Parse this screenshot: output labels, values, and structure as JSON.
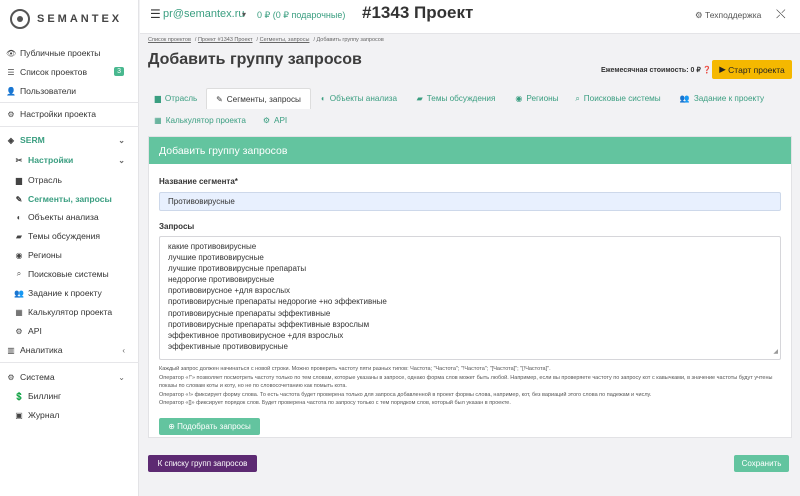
{
  "logo": {
    "text": "SEMANTEX"
  },
  "sidebar": {
    "items": [
      {
        "icon": "👁",
        "label": "Публичные проекты"
      },
      {
        "icon": "☰",
        "label": "Список проектов",
        "badge": "3"
      },
      {
        "icon": "👤",
        "label": "Пользователи"
      },
      {
        "icon": "⚙",
        "label": "Настройки проекта"
      },
      {
        "icon": "◈",
        "label": "SERM"
      },
      {
        "icon": "✂",
        "label": "Настройки"
      },
      {
        "icon": "▆",
        "label": "Отрасль"
      },
      {
        "icon": "✎",
        "label": "Сегменты, запросы"
      },
      {
        "icon": "◐",
        "label": "Объекты анализа"
      },
      {
        "icon": "▰",
        "label": "Темы обсуждения"
      },
      {
        "icon": "◉",
        "label": "Регионы"
      },
      {
        "icon": "⌕",
        "label": "Поисковые системы"
      },
      {
        "icon": "👥",
        "label": "Задание к проекту"
      },
      {
        "icon": "▦",
        "label": "Калькулятор проекта"
      },
      {
        "icon": "⚙",
        "label": "API"
      },
      {
        "icon": "▥",
        "label": "Аналитика"
      },
      {
        "icon": "⚙",
        "label": "Система"
      },
      {
        "icon": "💲",
        "label": "Биллинг"
      },
      {
        "icon": "▣",
        "label": "Журнал"
      }
    ]
  },
  "topbar": {
    "email": "pr@semantex.ru",
    "balance": "0 ₽ (0 ₽ подарочные)",
    "project_title": "#1343 Проект",
    "support": "Техподдержка"
  },
  "breadcrumb": [
    "Список проектов",
    "Проект #1343 Проект",
    "Сегменты, запросы",
    "Добавить группу запросов"
  ],
  "page": {
    "title": "Добавить группу запросов",
    "monthly_cost": "Ежемесячная стоимость: 0 ₽",
    "start_button": "Старт проекта"
  },
  "tabs": [
    {
      "icon": "▆",
      "label": "Отрасль"
    },
    {
      "icon": "✎",
      "label": "Сегменты, запросы"
    },
    {
      "icon": "◐",
      "label": "Объекты анализа"
    },
    {
      "icon": "▰",
      "label": "Темы обсуждения"
    },
    {
      "icon": "◉",
      "label": "Регионы"
    },
    {
      "icon": "⌕",
      "label": "Поисковые системы"
    },
    {
      "icon": "👥",
      "label": "Задание к проекту"
    },
    {
      "icon": "▦",
      "label": "Калькулятор проекта"
    },
    {
      "icon": "⚙",
      "label": "API"
    }
  ],
  "form": {
    "card_title": "Добавить группу запросов",
    "segment_label": "Название сегмента*",
    "segment_value": "Противовирусные",
    "queries_label": "Запросы",
    "queries": [
      "какие противовирусные",
      "лучшие противовирусные",
      "лучшие противовирусные препараты",
      "недорогие противовирусные",
      "противовирусное +для взрослых",
      "противовирусные препараты недорогие +но эффективные",
      "противовирусные препараты эффективные",
      "противовирусные препараты эффективные взрослым",
      "эффективное противовирусное +для взрослых",
      "эффективные противовирусные"
    ],
    "help": [
      "Каждый запрос должен начинаться с новой строки. Можно проверить частоту пяти разных типов: Частота; \"Частота\"; \"!Частота\"; \"[Частота]\"; \"[!Частота]\".",
      "Оператор «!\"» позволяет посмотреть частоту только по тем словам, которые указаны в запросе, однако форма слов может быть любой. Например, если вы проверяете частоту по запросу кот с кавычками, в значение частоты будут учтены показы по словам коты и коту, но не по словосочетанию как помыть кота.",
      "Оператор «!» фиксирует форму слова. То есть частота будет проверена только для запроса добавленной в проект формы слова, например, кот, без вариаций этого слова по падежам и числу.",
      "Оператор «[]» фиксирует порядок слов. Будет проверена частота по запросу только с тем порядком слов, который был указан в проекте."
    ],
    "pick_button": "Подобрать запросы"
  },
  "footer": {
    "back_button": "К списку групп запросов",
    "save_button": "Сохранить"
  }
}
